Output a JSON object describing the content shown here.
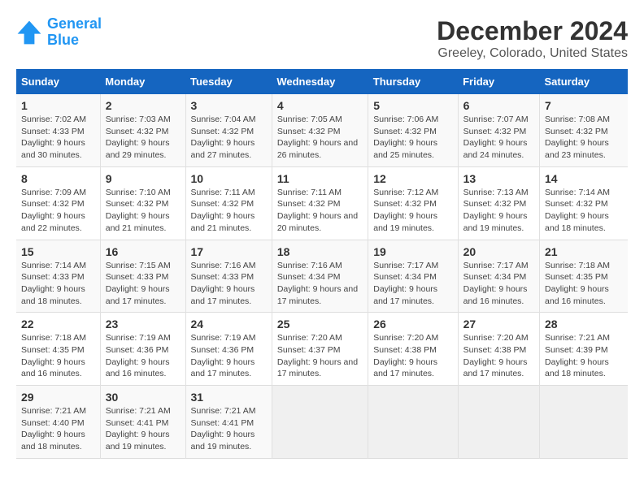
{
  "logo": {
    "line1": "General",
    "line2": "Blue"
  },
  "title": "December 2024",
  "subtitle": "Greeley, Colorado, United States",
  "days_of_week": [
    "Sunday",
    "Monday",
    "Tuesday",
    "Wednesday",
    "Thursday",
    "Friday",
    "Saturday"
  ],
  "weeks": [
    [
      {
        "day": "1",
        "info": "Sunrise: 7:02 AM\nSunset: 4:33 PM\nDaylight: 9 hours and 30 minutes."
      },
      {
        "day": "2",
        "info": "Sunrise: 7:03 AM\nSunset: 4:32 PM\nDaylight: 9 hours and 29 minutes."
      },
      {
        "day": "3",
        "info": "Sunrise: 7:04 AM\nSunset: 4:32 PM\nDaylight: 9 hours and 27 minutes."
      },
      {
        "day": "4",
        "info": "Sunrise: 7:05 AM\nSunset: 4:32 PM\nDaylight: 9 hours and 26 minutes."
      },
      {
        "day": "5",
        "info": "Sunrise: 7:06 AM\nSunset: 4:32 PM\nDaylight: 9 hours and 25 minutes."
      },
      {
        "day": "6",
        "info": "Sunrise: 7:07 AM\nSunset: 4:32 PM\nDaylight: 9 hours and 24 minutes."
      },
      {
        "day": "7",
        "info": "Sunrise: 7:08 AM\nSunset: 4:32 PM\nDaylight: 9 hours and 23 minutes."
      }
    ],
    [
      {
        "day": "8",
        "info": "Sunrise: 7:09 AM\nSunset: 4:32 PM\nDaylight: 9 hours and 22 minutes."
      },
      {
        "day": "9",
        "info": "Sunrise: 7:10 AM\nSunset: 4:32 PM\nDaylight: 9 hours and 21 minutes."
      },
      {
        "day": "10",
        "info": "Sunrise: 7:11 AM\nSunset: 4:32 PM\nDaylight: 9 hours and 21 minutes."
      },
      {
        "day": "11",
        "info": "Sunrise: 7:11 AM\nSunset: 4:32 PM\nDaylight: 9 hours and 20 minutes."
      },
      {
        "day": "12",
        "info": "Sunrise: 7:12 AM\nSunset: 4:32 PM\nDaylight: 9 hours and 19 minutes."
      },
      {
        "day": "13",
        "info": "Sunrise: 7:13 AM\nSunset: 4:32 PM\nDaylight: 9 hours and 19 minutes."
      },
      {
        "day": "14",
        "info": "Sunrise: 7:14 AM\nSunset: 4:32 PM\nDaylight: 9 hours and 18 minutes."
      }
    ],
    [
      {
        "day": "15",
        "info": "Sunrise: 7:14 AM\nSunset: 4:33 PM\nDaylight: 9 hours and 18 minutes."
      },
      {
        "day": "16",
        "info": "Sunrise: 7:15 AM\nSunset: 4:33 PM\nDaylight: 9 hours and 17 minutes."
      },
      {
        "day": "17",
        "info": "Sunrise: 7:16 AM\nSunset: 4:33 PM\nDaylight: 9 hours and 17 minutes."
      },
      {
        "day": "18",
        "info": "Sunrise: 7:16 AM\nSunset: 4:34 PM\nDaylight: 9 hours and 17 minutes."
      },
      {
        "day": "19",
        "info": "Sunrise: 7:17 AM\nSunset: 4:34 PM\nDaylight: 9 hours and 17 minutes."
      },
      {
        "day": "20",
        "info": "Sunrise: 7:17 AM\nSunset: 4:34 PM\nDaylight: 9 hours and 16 minutes."
      },
      {
        "day": "21",
        "info": "Sunrise: 7:18 AM\nSunset: 4:35 PM\nDaylight: 9 hours and 16 minutes."
      }
    ],
    [
      {
        "day": "22",
        "info": "Sunrise: 7:18 AM\nSunset: 4:35 PM\nDaylight: 9 hours and 16 minutes."
      },
      {
        "day": "23",
        "info": "Sunrise: 7:19 AM\nSunset: 4:36 PM\nDaylight: 9 hours and 16 minutes."
      },
      {
        "day": "24",
        "info": "Sunrise: 7:19 AM\nSunset: 4:36 PM\nDaylight: 9 hours and 17 minutes."
      },
      {
        "day": "25",
        "info": "Sunrise: 7:20 AM\nSunset: 4:37 PM\nDaylight: 9 hours and 17 minutes."
      },
      {
        "day": "26",
        "info": "Sunrise: 7:20 AM\nSunset: 4:38 PM\nDaylight: 9 hours and 17 minutes."
      },
      {
        "day": "27",
        "info": "Sunrise: 7:20 AM\nSunset: 4:38 PM\nDaylight: 9 hours and 17 minutes."
      },
      {
        "day": "28",
        "info": "Sunrise: 7:21 AM\nSunset: 4:39 PM\nDaylight: 9 hours and 18 minutes."
      }
    ],
    [
      {
        "day": "29",
        "info": "Sunrise: 7:21 AM\nSunset: 4:40 PM\nDaylight: 9 hours and 18 minutes."
      },
      {
        "day": "30",
        "info": "Sunrise: 7:21 AM\nSunset: 4:41 PM\nDaylight: 9 hours and 19 minutes."
      },
      {
        "day": "31",
        "info": "Sunrise: 7:21 AM\nSunset: 4:41 PM\nDaylight: 9 hours and 19 minutes."
      },
      {
        "day": "",
        "info": ""
      },
      {
        "day": "",
        "info": ""
      },
      {
        "day": "",
        "info": ""
      },
      {
        "day": "",
        "info": ""
      }
    ]
  ]
}
